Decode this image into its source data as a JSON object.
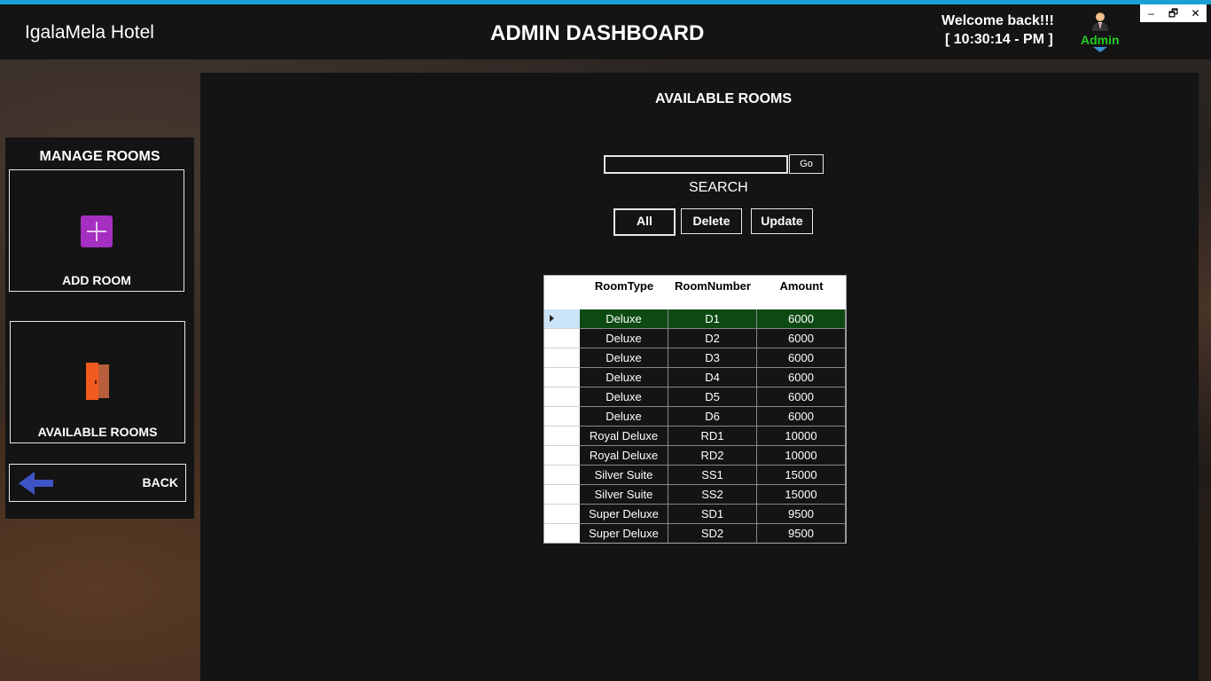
{
  "header": {
    "app_title": "IgalaMela Hotel",
    "dashboard_title": "ADMIN DASHBOARD",
    "welcome": "Welcome back!!!",
    "clock": "[ 10:30:14 - PM ]",
    "user_role": "Admin"
  },
  "window_controls": {
    "minimize": "‒",
    "restore": "🗗",
    "close": "✕"
  },
  "sidebar": {
    "title": "MANAGE ROOMS",
    "add_room": "ADD ROOM",
    "available_rooms": "AVAILABLE ROOMS",
    "back": "BACK"
  },
  "main": {
    "title": "AVAILABLE ROOMS",
    "search_value": "",
    "go_label": "Go",
    "search_label": "SEARCH",
    "buttons": {
      "all": "All",
      "delete": "Delete",
      "update": "Update"
    }
  },
  "table": {
    "columns": [
      "RoomType",
      "RoomNumber",
      "Amount"
    ],
    "rows": [
      [
        "Deluxe",
        "D1",
        "6000"
      ],
      [
        "Deluxe",
        "D2",
        "6000"
      ],
      [
        "Deluxe",
        "D3",
        "6000"
      ],
      [
        "Deluxe",
        "D4",
        "6000"
      ],
      [
        "Deluxe",
        "D5",
        "6000"
      ],
      [
        "Deluxe",
        "D6",
        "6000"
      ],
      [
        "Royal Deluxe",
        "RD1",
        "10000"
      ],
      [
        "Royal Deluxe",
        "RD2",
        "10000"
      ],
      [
        "Silver Suite",
        "SS1",
        "15000"
      ],
      [
        "Silver Suite",
        "SS2",
        "15000"
      ],
      [
        "Super Deluxe",
        "SD1",
        "9500"
      ],
      [
        "Super Deluxe",
        "SD2",
        "9500"
      ]
    ],
    "selected_row": 0
  },
  "colors": {
    "accent_stripe": "#1a9fd6",
    "admin_label": "#22cc22",
    "selected_row": "#0c4a12",
    "add_icon": "#a52fc0",
    "door_icon": "#f35a1e",
    "back_arrow": "#3f54c4"
  }
}
